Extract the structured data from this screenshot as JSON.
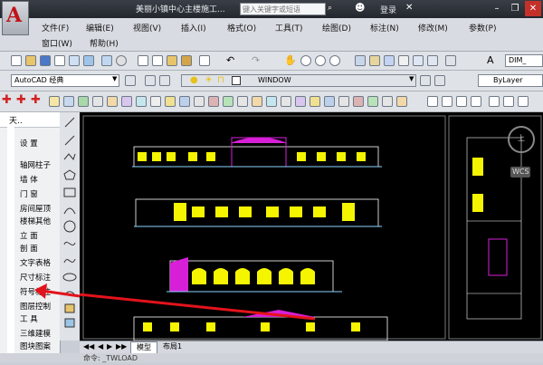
{
  "titlebar": {
    "title": "美丽小镇中心主楼施工...",
    "search_placeholder": "键入关键字或短语",
    "user": "登录"
  },
  "menus": {
    "row1": [
      "文件(F)",
      "编辑(E)",
      "视图(V)",
      "插入(I)",
      "格式(O)",
      "工具(T)",
      "绘图(D)",
      "标注(N)",
      "修改(M)",
      "参数(P)"
    ],
    "row2": [
      "窗口(W)",
      "帮助(H)"
    ]
  },
  "toolbar": {
    "workspace": "AutoCAD 经典",
    "layer": "WINDOW",
    "color": "ByLayer",
    "dimstyle": "DIM_"
  },
  "tianzheng": {
    "header": "天..",
    "items": [
      "设  置",
      "轴网柱子",
      "墙  体",
      "门  窗",
      "房间屋顶",
      "楼梯其他",
      "立  面",
      "剖  面",
      "文字表格",
      "尺寸标注",
      "符号标注",
      "图层控制",
      "工  具",
      "三维建模",
      "图块图案",
      "文件布图"
    ]
  },
  "drawing": {
    "viewcube_label": "上",
    "wcs_label": "WCS"
  },
  "tabs": [
    "模型",
    "布局1"
  ],
  "command": "命令: _TWLOAD",
  "colors": {
    "canvas": "#000000",
    "highlight_arrow": "#e3131b",
    "layer_yellow": "#f5f500",
    "magenta": "#d81fd8"
  }
}
